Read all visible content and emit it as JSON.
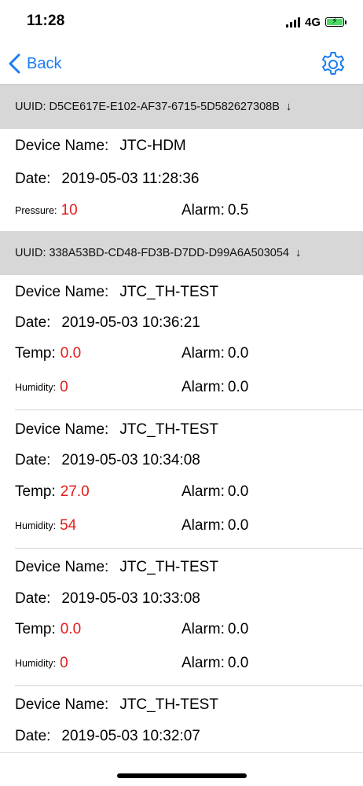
{
  "status_bar": {
    "time": "11:28",
    "network": "4G"
  },
  "nav": {
    "back_label": "Back"
  },
  "labels": {
    "device_name": "Device Name:",
    "date": "Date:",
    "pressure": "Pressure:",
    "temp": "Temp:",
    "humidity": "Humidity:",
    "alarm": "Alarm:"
  },
  "sections": [
    {
      "uuid": "UUID: D5CE617E-E102-AF37-6715-5D582627308B",
      "arrow": "↓",
      "records": [
        {
          "device_name": "JTC-HDM",
          "date": "2019-05-03 11:28:36",
          "pressure": "10",
          "pressure_alarm": "0.5"
        }
      ]
    },
    {
      "uuid": "UUID: 338A53BD-CD48-FD3B-D7DD-D99A6A503054",
      "arrow": "↓",
      "records": [
        {
          "device_name": "JTC_TH-TEST",
          "date": "2019-05-03 10:36:21",
          "temp": "0.0",
          "temp_alarm": "0.0",
          "humidity": "0",
          "humidity_alarm": "0.0"
        },
        {
          "device_name": "JTC_TH-TEST",
          "date": "2019-05-03 10:34:08",
          "temp": "27.0",
          "temp_alarm": "0.0",
          "humidity": "54",
          "humidity_alarm": "0.0"
        },
        {
          "device_name": "JTC_TH-TEST",
          "date": "2019-05-03 10:33:08",
          "temp": "0.0",
          "temp_alarm": "0.0",
          "humidity": "0",
          "humidity_alarm": "0.0"
        },
        {
          "device_name": "JTC_TH-TEST",
          "date": "2019-05-03 10:32:07"
        }
      ]
    }
  ],
  "colors": {
    "accent": "#1a7cf5",
    "value_red": "#e41c1c",
    "header_bg": "#d7d7d8"
  }
}
